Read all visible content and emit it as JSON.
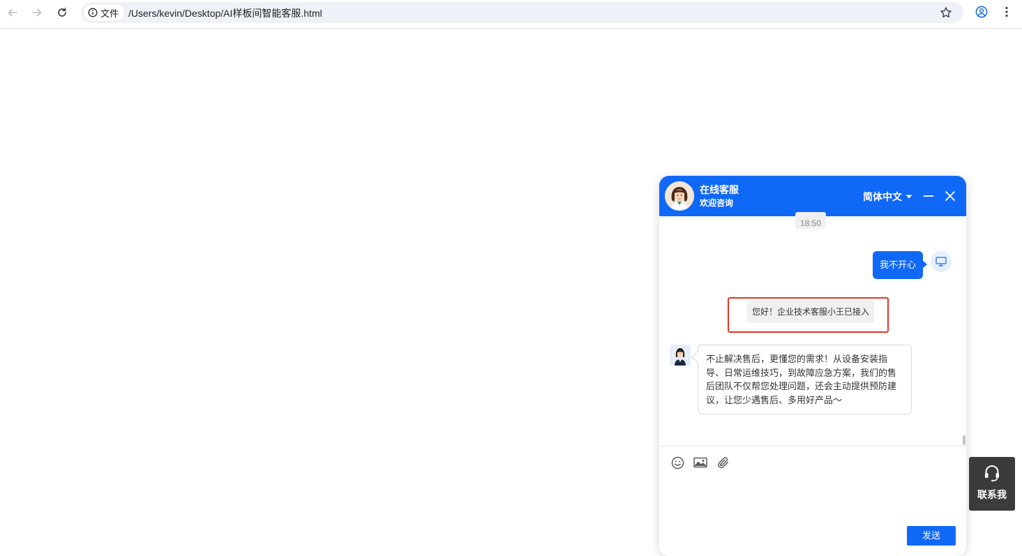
{
  "browser": {
    "site_info_label": "文件",
    "url": "/Users/kevin/Desktop/AI样板间智能客服.html"
  },
  "chat": {
    "title": "在线客服",
    "subtitle": "欢迎咨询",
    "language": "简体中文",
    "messages": {
      "time": "18:50",
      "user_message": "我不开心",
      "system_notice": "您好！企业技术客服小王已接入",
      "agent_message": "不止解决售后，更懂您的需求！从设备安装指导、日常运维技巧，到故障应急方案，我们的售后团队不仅帮您处理问题，还会主动提供预防建议，让您少遇售后、多用好产品～"
    },
    "send_label": "发送",
    "toolbar_icons": [
      "emoji-icon",
      "image-icon",
      "attachment-icon"
    ]
  },
  "contact": {
    "label": "联系我"
  },
  "colors": {
    "accent": "#1068f7",
    "highlight_border": "#e53228",
    "contact_bg": "#3b3b3b"
  }
}
